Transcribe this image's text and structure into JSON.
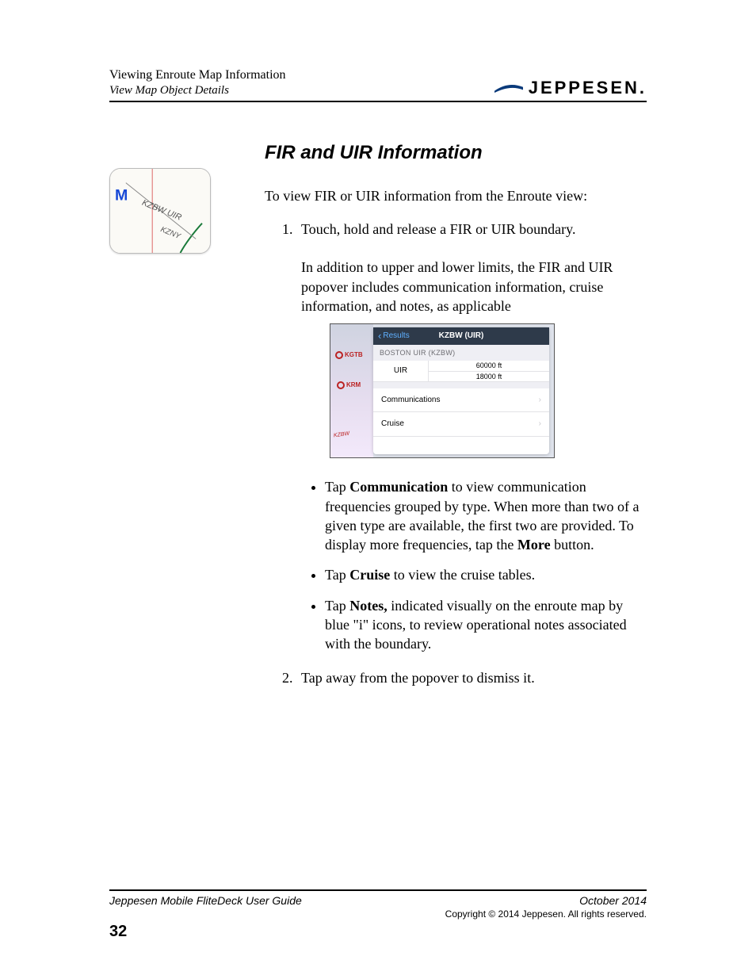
{
  "header": {
    "line1": "Viewing Enroute Map Information",
    "line2": "View Map Object Details",
    "brand": "JEPPESEN."
  },
  "section": {
    "heading": "FIR and UIR Information",
    "intro": "To view FIR or UIR information from the Enroute view:",
    "step1_lead": "Touch, hold and release a FIR or UIR boundary.",
    "step1_body": "In addition to upper and lower limits, the FIR and UIR popover includes communication information, cruise information, and notes, as applicable",
    "bullet1_a": "Tap ",
    "bullet1_b": "Communication",
    "bullet1_c": " to view communication frequencies grouped by type. When more than two of a given type are available, the first two are provided. To display more frequencies, tap the ",
    "bullet1_d": "More",
    "bullet1_e": " button.",
    "bullet2_a": "Tap ",
    "bullet2_b": "Cruise",
    "bullet2_c": " to view the cruise tables.",
    "bullet3_a": "Tap ",
    "bullet3_b": "Notes,",
    "bullet3_c": " indicated visually on the enroute map by blue \"i\" icons, to review operational notes associated with the boundary.",
    "step2": "Tap away from the popover to dismiss it."
  },
  "thumb": {
    "m": "M",
    "label1": "KZBW UIR",
    "label2": "KZNY"
  },
  "popover": {
    "back": "Results",
    "title": "KZBW (UIR)",
    "section": "BOSTON UIR (KZBW)",
    "row_label": "UIR",
    "val_upper": "60000 ft",
    "val_lower": "18000 ft",
    "link_comm": "Communications",
    "link_cruise": "Cruise",
    "map_lbl1": "KGTB",
    "map_lbl2": "KRM",
    "map_anno": "KZBW"
  },
  "footer": {
    "guide": "Jeppesen Mobile FliteDeck User Guide",
    "date": "October 2014",
    "copyright": "Copyright © 2014 Jeppesen. All rights reserved.",
    "page": "32"
  }
}
